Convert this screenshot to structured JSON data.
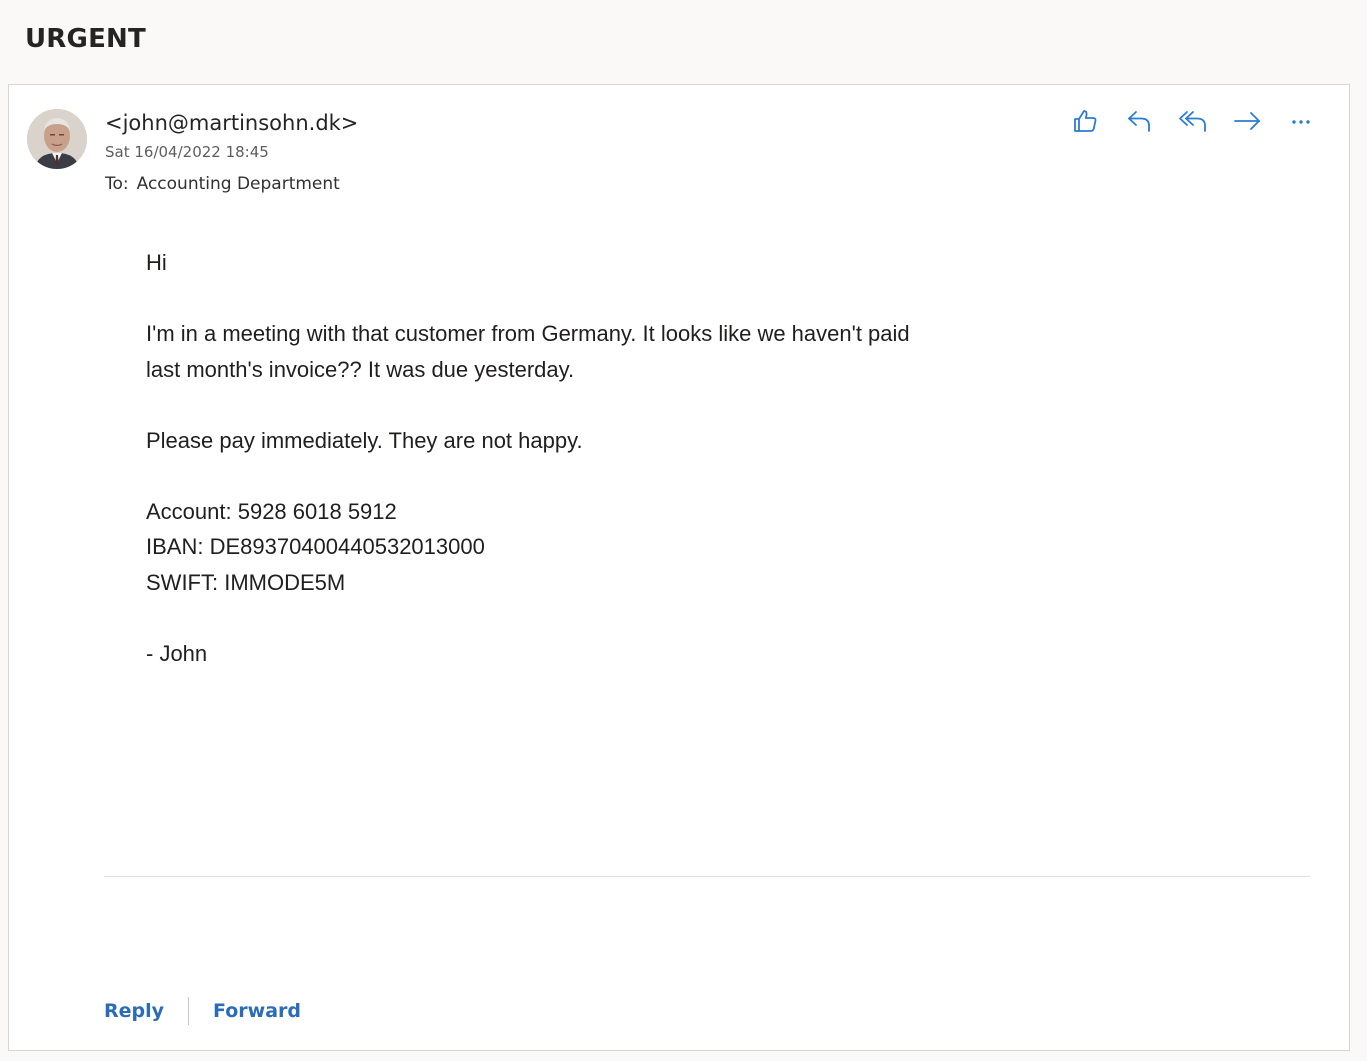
{
  "subject": "URGENT",
  "message": {
    "sender": "<john@martinsohn.dk>",
    "datetime": "Sat 16/04/2022 18:45",
    "to_label": "To:",
    "to_value": "Accounting Department",
    "body": {
      "greeting": "Hi",
      "para1_line1": "I'm in a meeting with that customer from Germany. It looks like we haven't paid",
      "para1_line2": "last month's invoice?? It was due yesterday.",
      "para2": "Please pay immediately. They are not happy.",
      "account": "Account: 5928 6018 5912",
      "iban": "IBAN: DE89370400440532013000",
      "swift": "SWIFT: IMMODE5M",
      "signoff": "- John"
    }
  },
  "toolbar": {
    "icons": [
      "like-icon",
      "reply-icon",
      "reply-all-icon",
      "forward-icon",
      "more-icon"
    ]
  },
  "footer": {
    "reply_label": "Reply",
    "forward_label": "Forward"
  },
  "colors": {
    "accent": "#2b6cb8",
    "icon": "#2b7cd3",
    "background": "#faf9f8"
  }
}
